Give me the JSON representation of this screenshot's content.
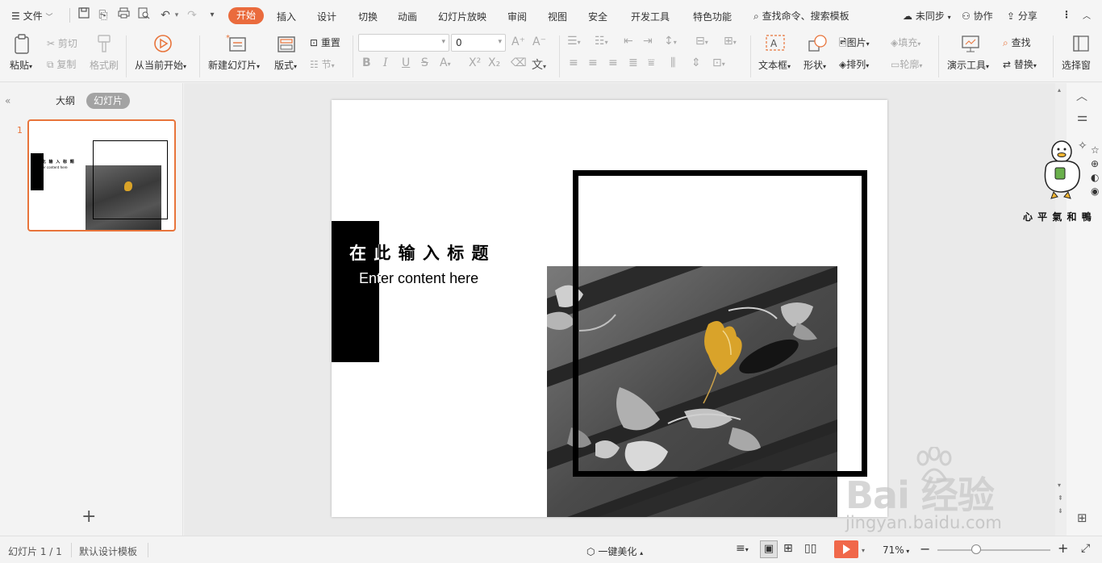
{
  "menu": {
    "file": "文件",
    "tabs": [
      "开始",
      "插入",
      "设计",
      "切换",
      "动画",
      "幻灯片放映",
      "审阅",
      "视图",
      "安全",
      "开发工具",
      "特色功能"
    ],
    "search_placeholder": "查找命令、搜索模板",
    "sync": "未同步",
    "collab": "协作",
    "share": "分享"
  },
  "ribbon": {
    "paste": "粘贴",
    "cut": "剪切",
    "copy": "复制",
    "format_painter": "格式刷",
    "play_from_current": "从当前开始",
    "new_slide": "新建幻灯片",
    "layout": "版式",
    "reset": "重置",
    "section": "节",
    "font_size_value": "0",
    "textbox": "文本框",
    "shape": "形状",
    "picture": "图片",
    "fill": "填充",
    "arrange": "排列",
    "outline": "轮廓",
    "present_tools": "演示工具",
    "find": "查找",
    "replace": "替换",
    "select_pane": "选择窗"
  },
  "left_pane": {
    "tab_outline": "大纲",
    "tab_slides": "幻灯片",
    "slide_number": "1"
  },
  "slide": {
    "title": "在 此 输 入 标 题",
    "subtitle": "Enter content here"
  },
  "status": {
    "slide_counter": "幻灯片 1 / 1",
    "template": "默认设计模板",
    "beautify": "一键美化",
    "zoom": "71%"
  },
  "sticker_text": "心 平 氣 和 鴨",
  "watermark": {
    "brand": "Bai  经验",
    "url": "jingyan.baidu.com"
  },
  "colors": {
    "accent": "#ea6b3d",
    "thumb_border": "#e8743b",
    "play_button": "#f0684a"
  }
}
